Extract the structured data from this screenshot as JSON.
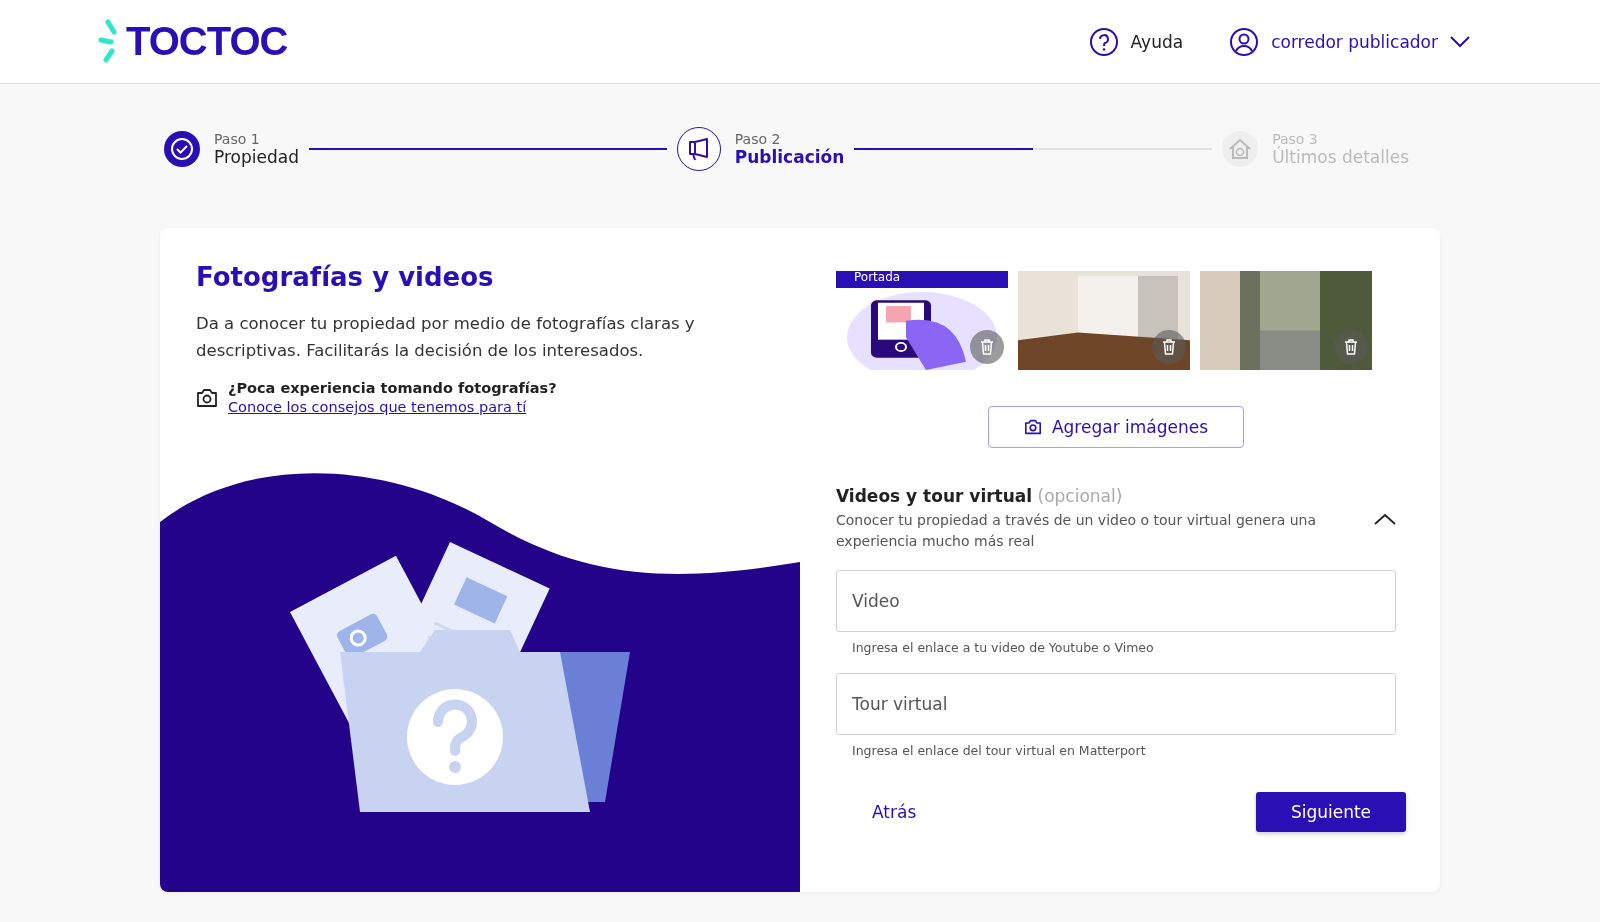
{
  "header": {
    "logo": "TOCTOC",
    "help": "Ayuda",
    "user": "corredor publicador"
  },
  "steps": [
    {
      "kind": "done",
      "caption": "Paso 1",
      "title": "Propiedad",
      "level": 1
    },
    {
      "kind": "current",
      "caption": "Paso 2",
      "title": "Publicación",
      "level": 0.5
    },
    {
      "kind": "pending",
      "caption": "Paso 3",
      "title": "Últimos detalles"
    }
  ],
  "intro": {
    "title": "Fotografías y videos",
    "text": "Da a conocer tu propiedad por medio de fotografías claras y descriptivas. Facilitarás la decisión de los interesados.",
    "tip_question": "¿Poca experiencia tomando fotografías?",
    "tip_link": "Conoce los consejos que tenemos para tí"
  },
  "photos": [
    {
      "kind": "illustration",
      "badge": "Portada"
    },
    {
      "kind": "room"
    },
    {
      "kind": "balcony"
    }
  ],
  "add_button": "Agregar imágenes",
  "videos": {
    "title": "Videos y tour virtual",
    "optional": "(opcional)",
    "text": "Conocer tu propiedad a través de un video o tour virtual genera una experiencia mucho más real",
    "expanded": true,
    "fields": [
      {
        "placeholder": "Video",
        "helper": "Ingresa el enlace a tu video de Youtube o Vimeo"
      },
      {
        "placeholder": "Tour virtual",
        "helper": "Ingresa el enlace del tour virtual en Matterport"
      }
    ]
  },
  "actions": {
    "back": "Atrás",
    "next": "Siguiente"
  }
}
